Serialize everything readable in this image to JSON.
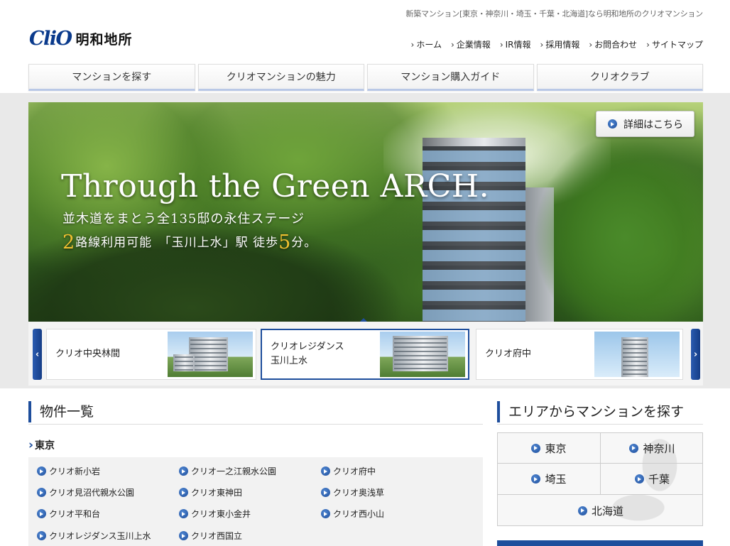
{
  "header": {
    "tagline": "新築マンション[東京・神奈川・埼玉・千葉・北海道]なら明和地所のクリオマンション",
    "logo_mark": "CliO",
    "logo_text": "明和地所",
    "util_nav": [
      "ホーム",
      "企業情報",
      "IR情報",
      "採用情報",
      "お問合わせ",
      "サイトマップ"
    ]
  },
  "global_nav": [
    "マンションを探す",
    "クリオマンションの魅力",
    "マンション購入ガイド",
    "クリオクラブ"
  ],
  "hero": {
    "title": "Through the Green ARCH.",
    "subtitle": "並木道をまとう全135邸の永住ステージ",
    "access_num1": "2",
    "access_text1": "路線利用可能　「玉川上水」駅 徒歩",
    "access_num2": "5",
    "access_text2": "分。",
    "detail_button": "詳細はこちら"
  },
  "carousel": {
    "prev": "‹",
    "next": "›",
    "items": [
      {
        "line1": "クリオ中央林間",
        "line2": ""
      },
      {
        "line1": "クリオレジダンス",
        "line2": "玉川上水"
      },
      {
        "line1": "クリオ府中",
        "line2": ""
      }
    ]
  },
  "properties": {
    "heading": "物件一覧",
    "region": "東京",
    "items": [
      "クリオ新小岩",
      "クリオ一之江親水公園",
      "クリオ府中",
      "クリオ見沼代親水公園",
      "クリオ東神田",
      "クリオ奥浅草",
      "クリオ平和台",
      "クリオ東小金井",
      "クリオ西小山",
      "クリオレジダンス玉川上水",
      "クリオ西国立"
    ]
  },
  "area": {
    "heading": "エリアからマンションを探す",
    "cells": [
      "東京",
      "神奈川",
      "埼玉",
      "千葉",
      "北海道"
    ]
  },
  "colors": {
    "brand_blue": "#1e4e9c",
    "accent_gold": "#f0c030"
  }
}
